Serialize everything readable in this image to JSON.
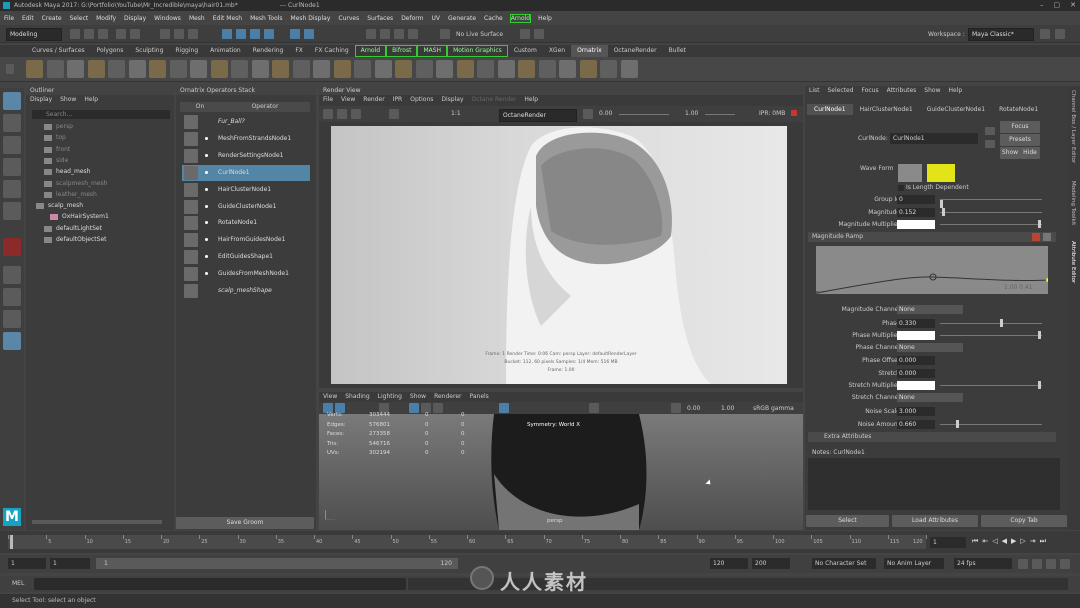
{
  "window": {
    "title": "Autodesk Maya 2017: G:\\Portfolio\\YouTube\\Mr_Incredible\\maya\\hair01.mb*",
    "title_suffix": "---  CurlNode1"
  },
  "menubar": [
    "File",
    "Edit",
    "Create",
    "Select",
    "Modify",
    "Display",
    "Windows",
    "Mesh",
    "Edit Mesh",
    "Mesh Tools",
    "Mesh Display",
    "Curves",
    "Surfaces",
    "Deform",
    "UV",
    "Generate",
    "Cache",
    "Arnold",
    "Help"
  ],
  "status": {
    "mode": "Modeling",
    "live_surface": "No Live Surface",
    "workspace_label": "Workspace :",
    "workspace": "Maya Classic*"
  },
  "shelf_tabs": [
    "Curves / Surfaces",
    "Polygons",
    "Sculpting",
    "Rigging",
    "Animation",
    "Rendering",
    "FX",
    "FX Caching",
    "Arnold",
    "Bifrost",
    "MASH",
    "Motion Graphics",
    "Custom",
    "XGen",
    "Ornatrix",
    "OctaneRender",
    "Bullet"
  ],
  "outliner": {
    "title": "Outliner",
    "menu": [
      "Display",
      "Show",
      "Help"
    ],
    "search": "Search...",
    "items": [
      "persp",
      "top",
      "front",
      "side",
      "head_mesh",
      "scalpmesh_mesh",
      "leather_mesh",
      "scalp_mesh",
      "OxHairSystem1",
      "defaultLightSet",
      "defaultObjectSet"
    ]
  },
  "ornatrix": {
    "title": "Ornatrix Operators Stack",
    "col_on": "On",
    "col_op": "Operator",
    "nodes": [
      "Fur_Ball?",
      "MeshFromStrandsNode1",
      "RenderSettingsNode1",
      "CurlNode1",
      "HairClusterNode1",
      "GuideClusterNode1",
      "RotateNode1",
      "HairFromGuidesNode1",
      "EditGuidesShape1",
      "GuidesFromMeshNode1",
      "scalp_meshShape"
    ],
    "save_button": "Save Groom"
  },
  "render_view": {
    "title": "Render View",
    "menu": [
      "File",
      "View",
      "Render",
      "IPR",
      "Options",
      "Display",
      "Octane Render",
      "Help"
    ],
    "renderer": "OctaneRender",
    "exposure": "0.00",
    "gamma": "1.00",
    "ipr": "IPR: 0MB",
    "info_line1": "Frame: 1  Render Time: 0:06  Cam: persp  Layer: defaultRenderLayer",
    "info_line2": "Bucket: 112, 60 pixels  Samples: 1/4  Mem: 516 MB",
    "info_line3": "Frame: 1.00"
  },
  "viewport": {
    "menu": [
      "View",
      "Shading",
      "Lighting",
      "Show",
      "Renderer",
      "Panels"
    ],
    "stats": [
      {
        "label": "Verts:",
        "a": "303444",
        "b": "0",
        "c": "0"
      },
      {
        "label": "Edges:",
        "a": "576801",
        "b": "0",
        "c": "0"
      },
      {
        "label": "Faces:",
        "a": "273358",
        "b": "0",
        "c": "0"
      },
      {
        "label": "Tris:",
        "a": "546716",
        "b": "0",
        "c": "0"
      },
      {
        "label": "UVs:",
        "a": "302194",
        "b": "0",
        "c": "0"
      }
    ],
    "symmetry": "Symmetry: World X",
    "camera": "persp",
    "field1": "0.00",
    "field2": "1.00",
    "colorspace": "sRGB gamma"
  },
  "attr": {
    "menu": [
      "List",
      "Selected",
      "Focus",
      "Attributes",
      "Show",
      "Help"
    ],
    "tabs": [
      "CurlNode1",
      "HairClusterNode1",
      "GuideClusterNode1",
      "RotateNode1"
    ],
    "node_label": "CurlNode:",
    "node_value": "CurlNode1",
    "focus": "Focus",
    "presets": "Presets",
    "show": "Show",
    "hide": "Hide",
    "wave_form": "Wave Form",
    "length_dep": "Is Length Dependent",
    "group_id_label": "Group Id",
    "group_id": "0",
    "magnitude_label": "Magnitude",
    "magnitude": "0.152",
    "mag_mult_label": "Magnitude Multiplier",
    "ramp_title": "Magnitude Ramp",
    "ramp_values": "1.00  0.41",
    "mag_channel_label": "Magnitude Channel",
    "mag_channel": "None",
    "phase_label": "Phase",
    "phase": "0.330",
    "phase_mult_label": "Phase Multiplier",
    "phase_channel_label": "Phase Channel",
    "phase_channel": "None",
    "phase_offset_label": "Phase Offset",
    "phase_offset": "0.000",
    "stretch_label": "Stretch",
    "stretch": "0.000",
    "stretch_mult_label": "Stretch Multiplier",
    "stretch_channel_label": "Stretch Channel",
    "stretch_channel": "None",
    "noise_scale_label": "Noise Scale",
    "noise_scale": "3.000",
    "noise_amount_label": "Noise Amount",
    "noise_amount": "0.660",
    "extra": "Extra Attributes",
    "notes": "Notes:  CurlNode1",
    "select": "Select",
    "load": "Load Attributes",
    "copy": "Copy Tab"
  },
  "side_tabs": [
    "Channel Box / Layer Editor",
    "Modeling Toolkit",
    "Attribute Editor"
  ],
  "timeline": {
    "ticks": [
      "1",
      "5",
      "10",
      "15",
      "20",
      "25",
      "30",
      "35",
      "40",
      "45",
      "50",
      "55",
      "60",
      "65",
      "70",
      "75",
      "80",
      "85",
      "90",
      "95",
      "100",
      "105",
      "110",
      "115",
      "120"
    ],
    "current": "1"
  },
  "range": {
    "start": "1",
    "start2": "1",
    "slider_start": "1",
    "slider_end": "120",
    "end": "120",
    "end2": "200",
    "char_set": "No Character Set",
    "anim_layer": "No Anim Layer",
    "fps": "24 fps"
  },
  "mel": {
    "label": "MEL"
  },
  "help_text": "Select Tool: select an object",
  "watermark": "人人素材"
}
